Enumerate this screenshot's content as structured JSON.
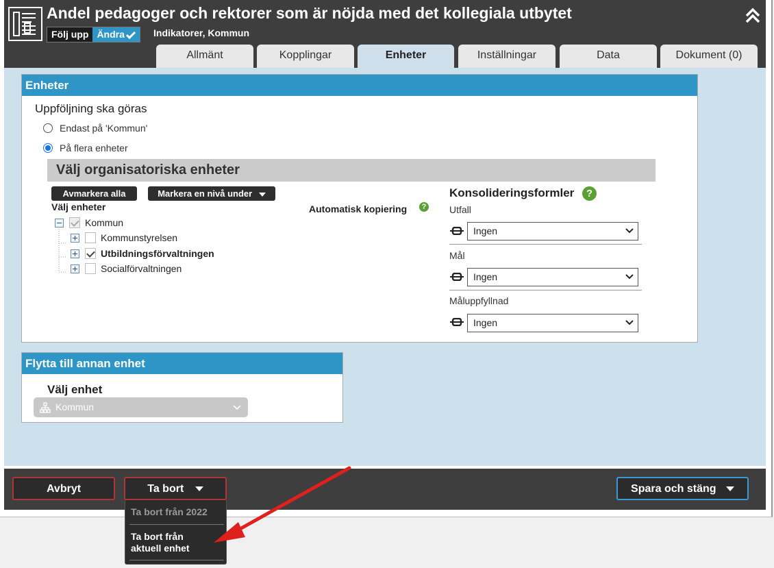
{
  "header": {
    "title": "Andel pedagoger och rektorer som är nöjda med det kollegiala utbytet",
    "mode_follow": "Följ upp",
    "mode_change": "Ändra",
    "subtitle": "Indikatorer, Kommun",
    "tabs": [
      {
        "label": "Allmänt"
      },
      {
        "label": "Kopplingar"
      },
      {
        "label": "Enheter"
      },
      {
        "label": "Inställningar"
      },
      {
        "label": "Data"
      },
      {
        "label": "Dokument (0)"
      }
    ],
    "active_tab": "Enheter"
  },
  "enheter": {
    "heading": "Enheter",
    "followup_title": "Uppföljning ska göras",
    "radio_only": "Endast på 'Kommun'",
    "radio_multi": "På flera enheter",
    "selected_radio": "På flera enheter",
    "org_title": "Välj organisatoriska enheter",
    "btn_unmark_all": "Avmarkera alla",
    "btn_mark_level": "Markera en nivå under",
    "choose_units": "Välj enheter",
    "tree": {
      "root": "Kommun",
      "children": [
        {
          "label": "Kommunstyrelsen",
          "checked": false
        },
        {
          "label": "Utbildningsförvaltningen",
          "checked": true
        },
        {
          "label": "Socialförvaltningen",
          "checked": false
        }
      ]
    },
    "auto_copy_label": "Automatisk kopiering",
    "consolidation_title": "Konsolideringsformler",
    "formulas": [
      {
        "label": "Utfall",
        "value": "Ingen"
      },
      {
        "label": "Mål",
        "value": "Ingen"
      },
      {
        "label": "Måluppfyllnad",
        "value": "Ingen"
      }
    ]
  },
  "move": {
    "heading": "Flytta till annan enhet",
    "choose_unit": "Välj enhet",
    "unit_value": "Kommun"
  },
  "footer": {
    "cancel": "Avbryt",
    "delete": "Ta bort",
    "save_close": "Spara och stäng",
    "delete_menu": [
      {
        "label": "Ta bort från 2022",
        "disabled": true
      },
      {
        "label": "Ta bort från aktuell enhet",
        "disabled": false
      }
    ]
  },
  "colors": {
    "accent_blue": "#2d96c7",
    "header_dark": "#3e3e3e",
    "content_bg": "#cde1ed",
    "annotation_arrow": "#e0201c"
  }
}
